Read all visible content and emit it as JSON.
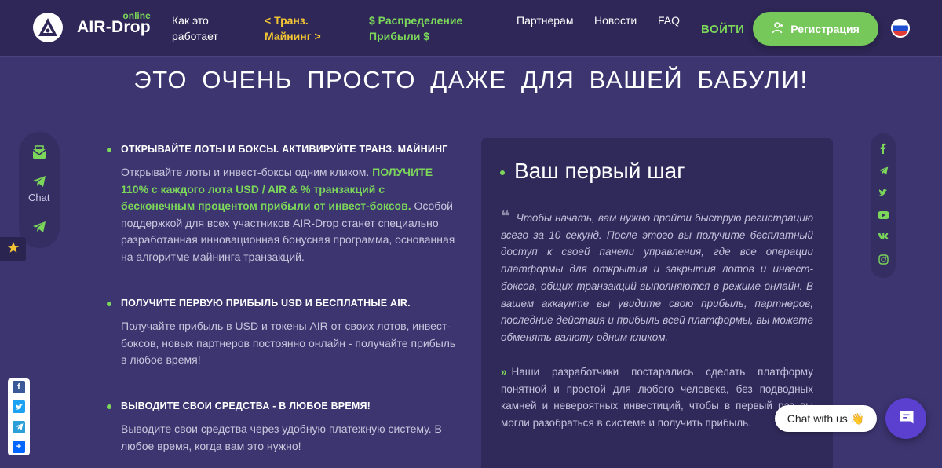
{
  "header": {
    "logo_main": "AIR-Drop",
    "logo_online": "online",
    "nav": [
      {
        "line1": "Как это",
        "line2": "работает"
      },
      {
        "line1": "< Транз.",
        "line2": "Майнинг >"
      },
      {
        "line1": "$ Распределение",
        "line2": "Прибыли $"
      },
      {
        "line1": "Партнерам"
      },
      {
        "line1": "Новости"
      },
      {
        "line1": "FAQ"
      }
    ],
    "login": "ВОЙТИ",
    "register": "Регистрация"
  },
  "hero_title": "ЭТО ОЧЕНЬ ПРОСТО ДАЖЕ ДЛЯ ВАШЕЙ БАБУЛИ!",
  "left_sidebar": {
    "chat_label": "Chat",
    "icons": [
      "mail-icon",
      "telegram-icon",
      "telegram-icon",
      "star-icon"
    ]
  },
  "features": [
    {
      "title": "ОТКРЫВАЙТЕ ЛОТЫ И БОКСЫ. АКТИВИРУЙТЕ ТРАНЗ. МАЙНИНГ",
      "text_before": "Открывайте лоты и инвест-боксы одним кликом.",
      "highlight": "ПОЛУЧИТЕ 110% с каждого лота USD / AIR & % транзакций с бесконечным процентом прибыли от инвест-боксов.",
      "text_after": "Особой поддержкой для всех участников AIR-Drop станет специально разработанная инновационная бонусная программа, основанная на алгоритме майнинга транзакций."
    },
    {
      "title": "ПОЛУЧИТЕ ПЕРВУЮ ПРИБЫЛЬ USD И БЕСПЛАТНЫЕ AIR.",
      "text": "Получайте прибыль в USD и токены AIR от своих лотов, инвест-боксов, новых партнеров постоянно онлайн - получайте прибыль в любое время!"
    },
    {
      "title": "ВЫВОДИТЕ СВОИ СРЕДСТВА - В ЛЮБОЕ ВРЕМЯ!",
      "text": "Выводите свои средства через удобную платежную систему. В любое время, когда вам это нужно!"
    }
  ],
  "card": {
    "title": "Ваш первый шаг",
    "quote": "Чтобы начать, вам нужно пройти быструю регистрацию всего за 10 секунд. После этого вы получите бесплатный доступ к своей панели управления, где все операции платформы для открытия и закрытия лотов и инвест-боксов, общих транзакций выполняются в режиме онлайн. В вашем аккаунте вы увидите свою прибыль, партнеров, последние действия и прибыль всей платформы, вы можете обменять валюту одним кликом.",
    "quote2": "Наши разработчики постарались сделать платформу понятной и простой для любого человека, без подводных камней и невероятных инвестиций, чтобы в первый раз вы могли разобраться в системе и получить прибыль."
  },
  "right_social": [
    "facebook-icon",
    "telegram-icon",
    "twitter-icon",
    "youtube-icon",
    "vk-icon",
    "instagram-icon"
  ],
  "share_bar": [
    "facebook-share",
    "twitter-share",
    "telegram-share",
    "more-share"
  ],
  "chat_widget": {
    "label": "Chat with us",
    "emoji": "👋"
  },
  "colors": {
    "accent_green": "#7bd65a",
    "accent_yellow": "#f3c534",
    "background": "#3d3570",
    "header": "#2e2757",
    "chat_button": "#5b3fcf"
  }
}
